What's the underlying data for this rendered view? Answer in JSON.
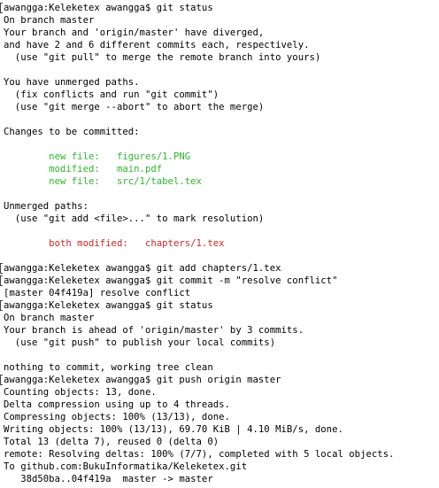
{
  "terminal": {
    "lines": [
      {
        "text": "awangga:Keleketex awangga$ git status",
        "color": "default",
        "prompt": true
      },
      {
        "text": "On branch master",
        "color": "default"
      },
      {
        "text": "Your branch and 'origin/master' have diverged,",
        "color": "default"
      },
      {
        "text": "and have 2 and 6 different commits each, respectively.",
        "color": "default"
      },
      {
        "text": "  (use \"git pull\" to merge the remote branch into yours)",
        "color": "default"
      },
      {
        "text": "",
        "color": "default"
      },
      {
        "text": "You have unmerged paths.",
        "color": "default"
      },
      {
        "text": "  (fix conflicts and run \"git commit\")",
        "color": "default"
      },
      {
        "text": "  (use \"git merge --abort\" to abort the merge)",
        "color": "default"
      },
      {
        "text": "",
        "color": "default"
      },
      {
        "text": "Changes to be committed:",
        "color": "default"
      },
      {
        "text": "",
        "color": "default"
      },
      {
        "text": "        new file:   figures/1.PNG",
        "color": "green"
      },
      {
        "text": "        modified:   main.pdf",
        "color": "green"
      },
      {
        "text": "        new file:   src/1/tabel.tex",
        "color": "green"
      },
      {
        "text": "",
        "color": "default"
      },
      {
        "text": "Unmerged paths:",
        "color": "default"
      },
      {
        "text": "  (use \"git add <file>...\" to mark resolution)",
        "color": "default"
      },
      {
        "text": "",
        "color": "default"
      },
      {
        "text": "        both modified:   chapters/1.tex",
        "color": "red"
      },
      {
        "text": "",
        "color": "default"
      },
      {
        "text": "awangga:Keleketex awangga$ git add chapters/1.tex",
        "color": "default",
        "prompt": true
      },
      {
        "text": "awangga:Keleketex awangga$ git commit -m \"resolve conflict\"",
        "color": "default",
        "prompt": true
      },
      {
        "text": "[master 04f419a] resolve conflict",
        "color": "default"
      },
      {
        "text": "awangga:Keleketex awangga$ git status",
        "color": "default",
        "prompt": true
      },
      {
        "text": "On branch master",
        "color": "default"
      },
      {
        "text": "Your branch is ahead of 'origin/master' by 3 commits.",
        "color": "default"
      },
      {
        "text": "  (use \"git push\" to publish your local commits)",
        "color": "default"
      },
      {
        "text": "",
        "color": "default"
      },
      {
        "text": "nothing to commit, working tree clean",
        "color": "default"
      },
      {
        "text": "awangga:Keleketex awangga$ git push origin master",
        "color": "default",
        "prompt": true
      },
      {
        "text": "Counting objects: 13, done.",
        "color": "default"
      },
      {
        "text": "Delta compression using up to 4 threads.",
        "color": "default"
      },
      {
        "text": "Compressing objects: 100% (13/13), done.",
        "color": "default"
      },
      {
        "text": "Writing objects: 100% (13/13), 69.70 KiB | 4.10 MiB/s, done.",
        "color": "default"
      },
      {
        "text": "Total 13 (delta 7), reused 0 (delta 0)",
        "color": "default"
      },
      {
        "text": "remote: Resolving deltas: 100% (7/7), completed with 5 local objects.",
        "color": "default"
      },
      {
        "text": "To github.com:BukuInformatika/Keleketex.git",
        "color": "default"
      },
      {
        "text": "   38d50ba..04f419a  master -> master",
        "color": "default"
      }
    ],
    "colors": {
      "default": "#000000",
      "green": "#2fb52f",
      "red": "#c72a2a",
      "background": "#ffffff"
    }
  }
}
